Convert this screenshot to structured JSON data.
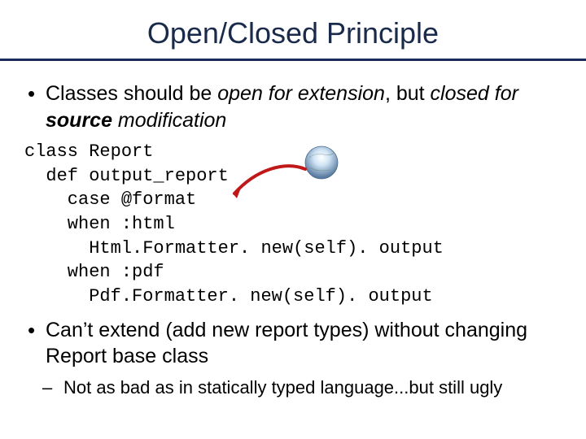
{
  "title": "Open/Closed Principle",
  "bullet1_pre": "Classes should be ",
  "bullet1_ital1": "open for extension",
  "bullet1_mid": ", but ",
  "bullet1_ital2_a": "closed for ",
  "bullet1_bold": "source",
  "bullet1_ital2_b": " modification",
  "code": "class Report\n  def output_report\n    case @format\n    when :html\n      Html.Formatter. new(self). output\n    when :pdf\n      Pdf.Formatter. new(self). output",
  "bullet2": "Can’t extend (add new report types) without changing Report base class",
  "bullet3": "Not as bad as in statically typed language...but still ugly"
}
